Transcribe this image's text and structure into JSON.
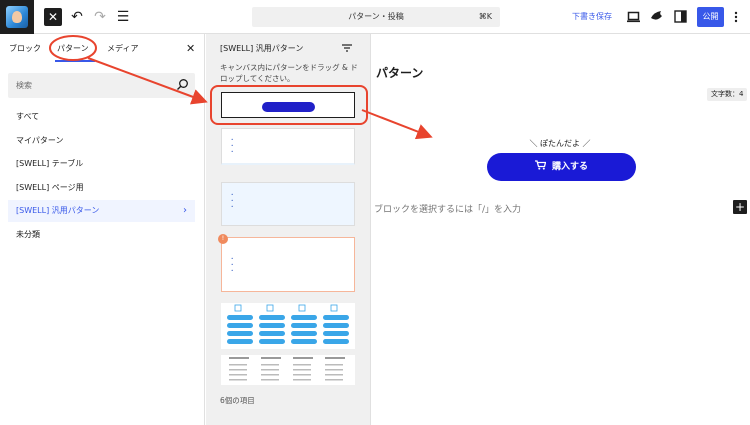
{
  "topbar": {
    "command_title": "パターン・投稿",
    "command_shortcut": "⌘K",
    "save_draft_label": "下書き保存",
    "publish_label": "公開",
    "close_symbol": "✕",
    "undo_symbol": "↶",
    "redo_symbol": "↷",
    "list_view_symbol": "☰"
  },
  "inserter": {
    "tabs": [
      {
        "label": "ブロック"
      },
      {
        "label": "パターン"
      },
      {
        "label": "メディア"
      }
    ],
    "close_symbol": "✕",
    "search_placeholder": "検索",
    "categories": [
      {
        "label": "すべて"
      },
      {
        "label": "マイパターン"
      },
      {
        "label": "[SWELL] テーブル"
      },
      {
        "label": "[SWELL] ページ用"
      },
      {
        "label": "[SWELL] 汎用パターン"
      },
      {
        "label": "未分類"
      }
    ],
    "selected_chevron": "›"
  },
  "pattern_panel": {
    "title": "[SWELL] 汎用パターン",
    "description": "キャンバス内にパターンをドラッグ & ドロップしてください。",
    "count_label": "6個の項目"
  },
  "canvas": {
    "title": "パターン",
    "char_count": "文字数：4",
    "decoration_text": "＼ ぽたんだよ ／",
    "buy_button_label": "購入する",
    "placeholder": "ブロックを選択するには「/」を入力",
    "add_symbol": "+"
  },
  "colors": {
    "accent": "#3858e9",
    "buy_button": "#1a1ad6",
    "annotation_red": "#e8442e"
  }
}
